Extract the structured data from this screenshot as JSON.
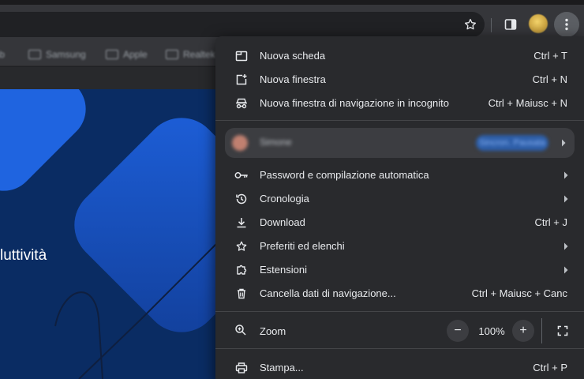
{
  "bookmarks": [
    "lab",
    "Samsung",
    "Apple",
    "Realtek"
  ],
  "hero": {
    "text": "luttività"
  },
  "menu": {
    "items": [
      {
        "label": "Nuova scheda",
        "shortcut": "Ctrl + T",
        "icon": "new-tab-icon"
      },
      {
        "label": "Nuova finestra",
        "shortcut": "Ctrl + N",
        "icon": "new-window-icon"
      },
      {
        "label": "Nuova finestra di navigazione in incognito",
        "shortcut": "Ctrl + Maiusc + N",
        "icon": "incognito-icon"
      },
      {
        "label": "Password e compilazione automatica",
        "icon": "key-icon"
      },
      {
        "label": "Cronologia",
        "icon": "history-icon"
      },
      {
        "label": "Download",
        "shortcut": "Ctrl + J",
        "icon": "download-icon"
      },
      {
        "label": "Preferiti ed elenchi",
        "icon": "star-icon"
      },
      {
        "label": "Estensioni",
        "icon": "extension-icon"
      },
      {
        "label": "Cancella dati di navigazione...",
        "shortcut": "Ctrl + Maiusc + Canc",
        "icon": "trash-icon"
      },
      {
        "label": "Stampa...",
        "shortcut": "Ctrl + P",
        "icon": "print-icon"
      }
    ],
    "profile": {
      "name": "Simone",
      "status": "Sincron. Pausata"
    },
    "zoom": {
      "label": "Zoom",
      "value": "100%",
      "minus": "−",
      "plus": "+"
    }
  }
}
